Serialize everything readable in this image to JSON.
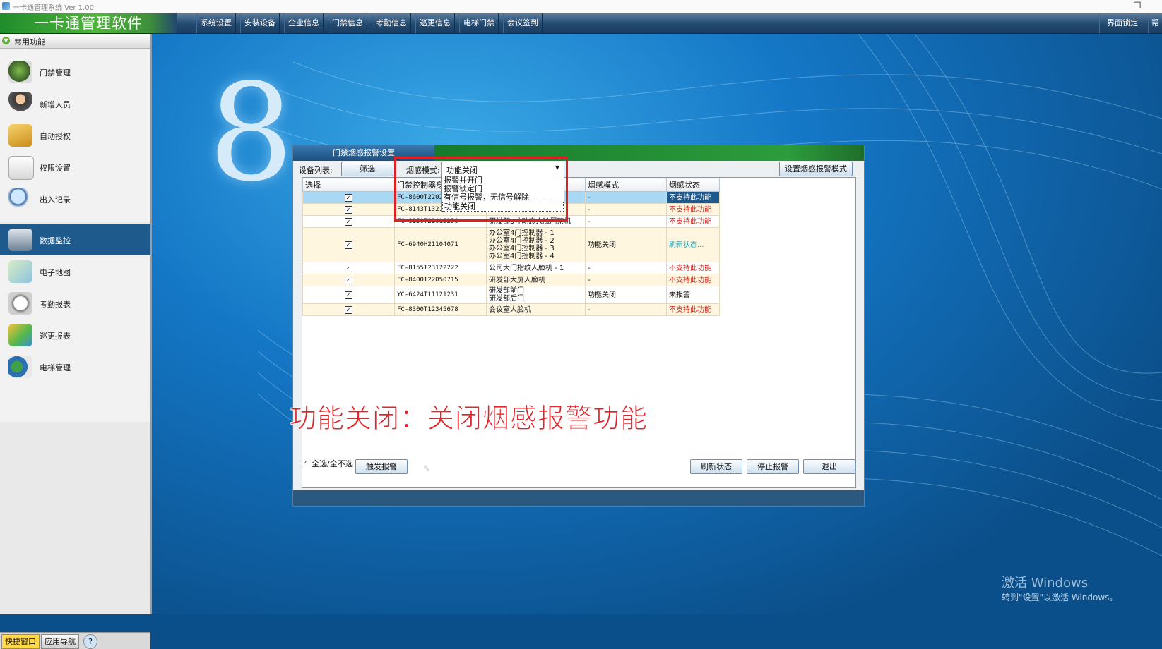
{
  "window": {
    "title": "一卡通管理系统  Ver 1.00"
  },
  "menubar": {
    "brand": "一卡通管理软件",
    "items": [
      "系统设置",
      "安装设备",
      "企业信息",
      "门禁信息",
      "考勤信息",
      "巡更信息",
      "电梯门禁",
      "会议签到"
    ],
    "lock": "界面锁定",
    "help": "帮"
  },
  "sidebar": {
    "header": "常用功能",
    "group1": [
      "门禁管理",
      "新增人员",
      "自动授权",
      "权限设置",
      "出入记录"
    ],
    "group2": [
      "数据监控",
      "电子地图",
      "考勤报表",
      "巡更报表",
      "电梯管理"
    ],
    "active": "数据监控"
  },
  "bottom_tabs": [
    "快捷窗口",
    "应用导航",
    "?"
  ],
  "dialog": {
    "tab_title": "门禁烟感报警设置",
    "device_list_label": "设备列表:",
    "filter_button": "筛选",
    "smoke_mode_label": "烟感模式:",
    "smoke_mode_value": "功能关闭",
    "set_button": "设置烟感报警模式",
    "dropdown_options": [
      "报警并开门",
      "报警锁定门",
      "有信号报警，无信号解除",
      "功能关闭"
    ],
    "columns": [
      "选择",
      "门禁控制器身份",
      "",
      "烟感模式",
      "烟感状态"
    ],
    "rows": [
      {
        "id": "FC-8600T22026",
        "name": "",
        "mode": "-",
        "status": "不支持此功能",
        "status_color": "red-on-blue"
      },
      {
        "id": "FC-8143T13216",
        "name": "",
        "mode": "-",
        "status": "不支持此功能",
        "status_color": "red"
      },
      {
        "id": "FC-8150T22015256",
        "name": "研发部5寸动态人脸门禁机",
        "mode": "-",
        "status": "不支持此功能",
        "status_color": "red"
      },
      {
        "id": "FC-6940H21104071",
        "name": "办公室4门控制器 - 1\n办公室4门控制器 - 2\n办公室4门控制器 - 3\n办公室4门控制器 - 4",
        "mode": "功能关闭",
        "status": "刷新状态...",
        "status_color": "teal"
      },
      {
        "id": "FC-8155T23122222",
        "name": "公司大门指纹人脸机 - 1",
        "mode": "-",
        "status": "不支持此功能",
        "status_color": "red"
      },
      {
        "id": "FC-8400T22050715",
        "name": "研发部大屏人脸机",
        "mode": "-",
        "status": "不支持此功能",
        "status_color": "red"
      },
      {
        "id": "YC-6424T11121231",
        "name": "研发部前门\n研发部后门",
        "mode": "功能关闭",
        "status": "未报警",
        "status_color": "black"
      },
      {
        "id": "FC-8300T12345678",
        "name": "会议室人脸机",
        "mode": "-",
        "status": "不支持此功能",
        "status_color": "red"
      }
    ],
    "select_all_label": "全选/全不选",
    "trigger_button": "触发报警",
    "refresh_button": "刷新状态",
    "stop_button": "停止报警",
    "exit_button": "退出"
  },
  "overlay_subtitle": "功能关闭：关闭烟感报警功能",
  "watermark": {
    "line1": "激活 Windows",
    "line2": "转到\"设置\"以激活 Windows。"
  },
  "decor": {
    "big_digit": "8"
  },
  "colors": {
    "accent_green": "#2c9c3c",
    "menubar_blue": "#23496f",
    "status_red": "#d4261c",
    "status_teal": "#20a3b3",
    "subtitle_red": "#e3252b"
  }
}
